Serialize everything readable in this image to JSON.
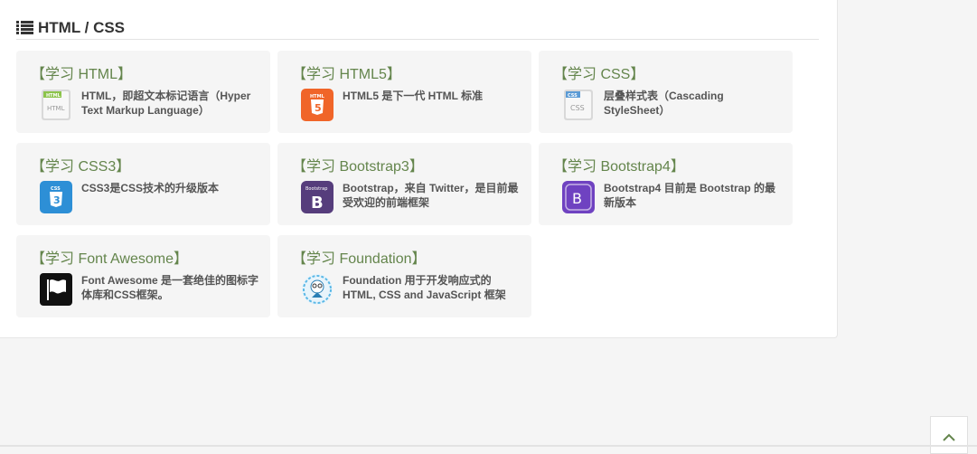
{
  "section": {
    "title": "HTML / CSS",
    "icon": "list-icon"
  },
  "accent_color": "#64854c",
  "cards": [
    {
      "title": "【学习 HTML】",
      "desc": "HTML，即超文本标记语言（Hyper Text Markup Language）",
      "icon": "html-icon"
    },
    {
      "title": "【学习 HTML5】",
      "desc": "HTML5 是下一代 HTML 标准",
      "icon": "html5-icon"
    },
    {
      "title": "【学习 CSS】",
      "desc": "层叠样式表（Cascading StyleSheet）",
      "icon": "css-icon"
    },
    {
      "title": "【学习 CSS3】",
      "desc": "CSS3是CSS技术的升级版本",
      "icon": "css3-icon"
    },
    {
      "title": "【学习 Bootstrap3】",
      "desc": "Bootstrap，来自 Twitter，是目前最受欢迎的前端框架",
      "icon": "bootstrap3-icon"
    },
    {
      "title": "【学习 Bootstrap4】",
      "desc": "Bootstrap4 目前是 Bootstrap 的最新版本",
      "icon": "bootstrap4-icon"
    },
    {
      "title": "【学习 Font Awesome】",
      "desc": "Font Awesome 是一套绝佳的图标字体库和CSS框架。",
      "icon": "font-awesome-flag-icon"
    },
    {
      "title": "【学习 Foundation】",
      "desc": "Foundation 用于开发响应式的 HTML, CSS and JavaScript 框架",
      "icon": "foundation-icon"
    }
  ],
  "back_to_top": {
    "icon": "chevron-up-icon"
  }
}
